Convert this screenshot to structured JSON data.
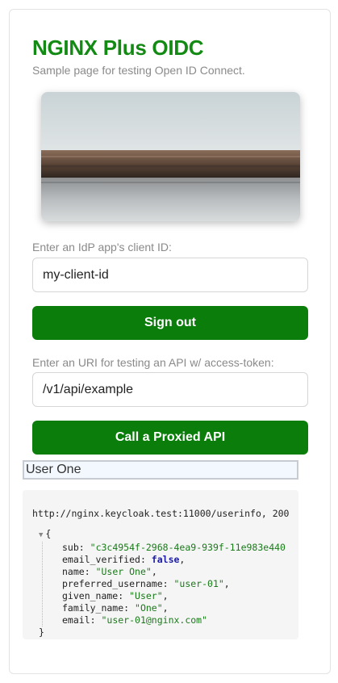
{
  "header": {
    "title": "NGINX Plus OIDC",
    "subtitle": "Sample page for testing Open ID Connect."
  },
  "client_id": {
    "label": "Enter an IdP app's client ID:",
    "value": "my-client-id"
  },
  "sign_out_label": "Sign out",
  "api": {
    "label": "Enter an URI for testing an API w/ access-token:",
    "value": "/v1/api/example"
  },
  "call_api_label": "Call a Proxied API",
  "user_name": "User One",
  "response": {
    "url_line": "http://nginx.keycloak.test:11000/userinfo, 200",
    "open_brace": "{",
    "close_brace": "}",
    "fields": [
      {
        "key": "sub",
        "value": "\"c3c4954f-2968-4ea9-939f-11e983e440"
      },
      {
        "key": "email_verified",
        "value": "false"
      },
      {
        "key": "name",
        "value": "\"User One\""
      },
      {
        "key": "preferred_username",
        "value": "\"user-01\""
      },
      {
        "key": "given_name",
        "value": "\"User\""
      },
      {
        "key": "family_name",
        "value": "\"One\""
      },
      {
        "key": "email",
        "value": "\"user-01@nginx.com\""
      }
    ]
  },
  "colors": {
    "accent": "#0b7d0b",
    "title": "#138a13"
  }
}
